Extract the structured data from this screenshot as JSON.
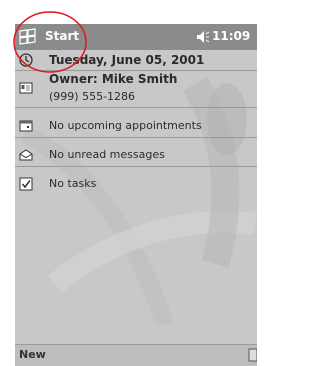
{
  "titlebar": {
    "start_label": "Start",
    "time": "11:09"
  },
  "today": {
    "date": "Tuesday, June 05, 2001",
    "owner_name": "Owner: Mike Smith",
    "owner_phone": "(999) 555-1286",
    "appointments": "No upcoming appointments",
    "messages": "No unread messages",
    "tasks": "No tasks"
  },
  "command_bar": {
    "new_label": "New"
  },
  "colors": {
    "titlebar": "#8b8b8b",
    "screen": "#c8c8c8",
    "annotation": "#e0151b"
  }
}
